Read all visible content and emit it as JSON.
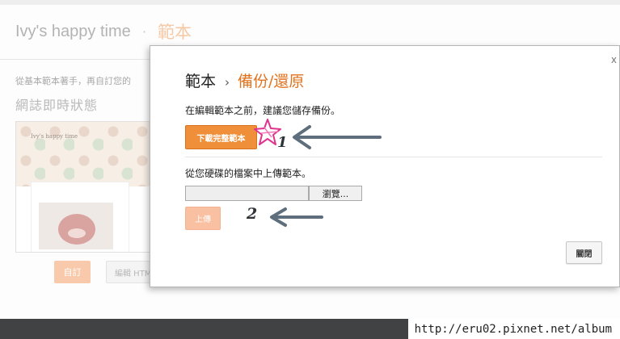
{
  "blog": {
    "title": "Ivy's happy time",
    "separator": "·",
    "section": "範本"
  },
  "background": {
    "intro_text": "從基本範本著手，再自訂您的",
    "live_heading": "網誌即時狀態",
    "thumbnail_blog_name": "Ivy's happy time",
    "customize_button": "自訂",
    "edit_html_button": "編輯 HTML"
  },
  "dialog": {
    "close_glyph": "x",
    "breadcrumb_parent": "範本",
    "breadcrumb_separator": "›",
    "breadcrumb_current": "備份/還原",
    "backup_description": "在編輯範本之前，建議您儲存備份。",
    "download_button": "下載完整範本",
    "upload_description": "從您硬碟的檔案中上傳範本。",
    "file_path_value": "",
    "browse_button": "瀏覽...",
    "upload_button": "上傳",
    "close_button": "關閉"
  },
  "annotations": {
    "step_1": "1",
    "step_2": "2",
    "arrow_color": "#5f6e7c",
    "star_color": "#e0338e"
  },
  "watermark": {
    "url": "http://eru02.pixnet.net/album"
  },
  "colors": {
    "accent": "#f08f39",
    "accent_text": "#e2731e",
    "disabled_accent": "#f9c0a1"
  }
}
